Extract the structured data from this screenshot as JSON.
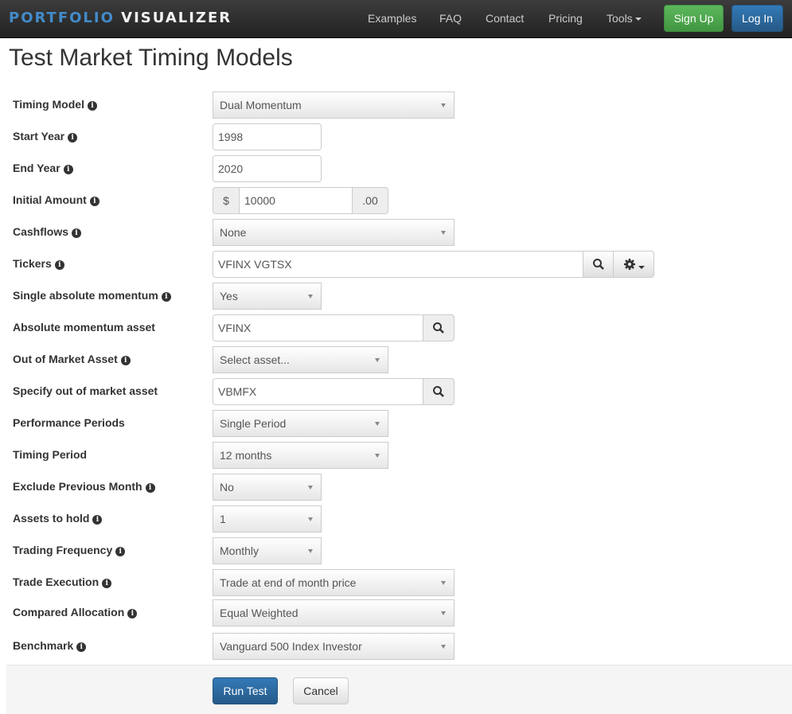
{
  "navbar": {
    "brand_part1": "PORTFOLIO",
    "brand_part2": "VISUALIZER",
    "links": [
      "Examples",
      "FAQ",
      "Contact",
      "Pricing",
      "Tools"
    ],
    "signup": "Sign Up",
    "login": "Log In"
  },
  "page_title": "Test Market Timing Models",
  "form": {
    "timing_model": {
      "label": "Timing Model",
      "value": "Dual Momentum"
    },
    "start_year": {
      "label": "Start Year",
      "value": "1998"
    },
    "end_year": {
      "label": "End Year",
      "value": "2020"
    },
    "initial_amount": {
      "label": "Initial Amount",
      "prefix": "$",
      "value": "10000",
      "suffix": ".00"
    },
    "cashflows": {
      "label": "Cashflows",
      "value": "None"
    },
    "tickers": {
      "label": "Tickers",
      "value": "VFINX VGTSX"
    },
    "single_abs_momentum": {
      "label": "Single absolute momentum",
      "value": "Yes"
    },
    "abs_momentum_asset": {
      "label": "Absolute momentum asset",
      "value": "VFINX"
    },
    "out_of_market_asset": {
      "label": "Out of Market Asset",
      "value": "Select asset..."
    },
    "specify_out_asset": {
      "label": "Specify out of market asset",
      "value": "VBMFX"
    },
    "performance_periods": {
      "label": "Performance Periods",
      "value": "Single Period"
    },
    "timing_period": {
      "label": "Timing Period",
      "value": "12 months"
    },
    "exclude_prev_month": {
      "label": "Exclude Previous Month",
      "value": "No"
    },
    "assets_to_hold": {
      "label": "Assets to hold",
      "value": "1"
    },
    "trading_frequency": {
      "label": "Trading Frequency",
      "value": "Monthly"
    },
    "trade_execution": {
      "label": "Trade Execution",
      "value": "Trade at end of month price"
    },
    "compared_allocation": {
      "label": "Compared Allocation",
      "value": "Equal Weighted"
    },
    "benchmark": {
      "label": "Benchmark",
      "value": "Vanguard 500 Index Investor"
    }
  },
  "actions": {
    "run": "Run Test",
    "cancel": "Cancel"
  },
  "info_glyph": "i"
}
